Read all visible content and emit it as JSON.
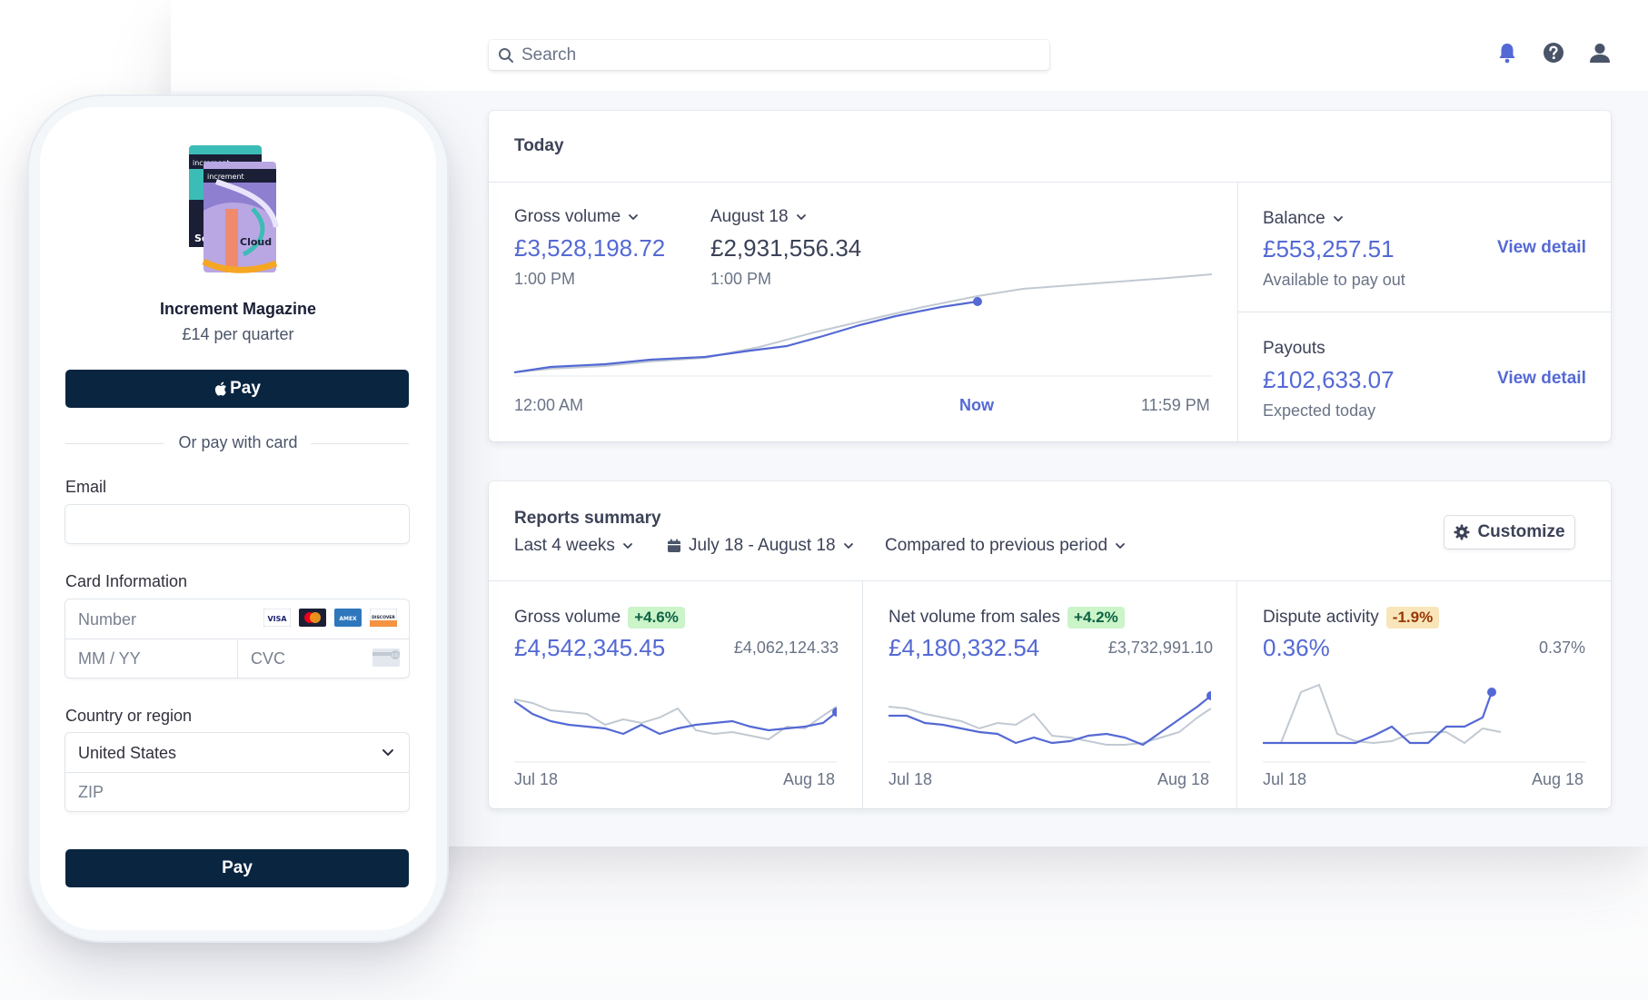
{
  "search": {
    "placeholder": "Search"
  },
  "today": {
    "title": "Today",
    "gross_volume": {
      "label": "Gross volume",
      "value": "£3,528,198.72",
      "time": "1:00 PM"
    },
    "compare_day": {
      "label": "August 18",
      "value": "£2,931,556.34",
      "time": "1:00 PM"
    },
    "axis": {
      "start": "12:00 AM",
      "now": "Now",
      "end": "11:59 PM"
    },
    "balance": {
      "label": "Balance",
      "value": "£553,257.51",
      "sub": "Available to pay out",
      "link": "View detail"
    },
    "payouts": {
      "label": "Payouts",
      "value": "£102,633.07",
      "sub": "Expected today",
      "link": "View detail"
    }
  },
  "reports": {
    "title": "Reports summary",
    "filter_period": "Last 4 weeks",
    "filter_dates": "July 18 - August 18",
    "filter_compare": "Compared to previous period",
    "customize_label": "Customize",
    "panels": [
      {
        "label": "Gross volume",
        "badge": "+4.6%",
        "value": "£4,542,345.45",
        "previous": "£4,062,124.33",
        "axis_start": "Jul 18",
        "axis_end": "Aug 18"
      },
      {
        "label": "Net volume from sales",
        "badge": "+4.2%",
        "value": "£4,180,332.54",
        "previous": "£3,732,991.10",
        "axis_start": "Jul 18",
        "axis_end": "Aug 18"
      },
      {
        "label": "Dispute activity",
        "badge": "-1.9%",
        "value": "0.36%",
        "previous": "0.37%",
        "axis_start": "Jul 18",
        "axis_end": "Aug 18"
      }
    ]
  },
  "checkout": {
    "product_name": "Increment Magazine",
    "product_price": "£14 per quarter",
    "product_art_text": [
      "increment",
      "increment",
      "Cloud",
      "So"
    ],
    "apple_pay_label": "Pay",
    "divider_text": "Or pay with card",
    "email_label": "Email",
    "email_value": "",
    "card_label": "Card Information",
    "number_placeholder": "Number",
    "expiry_placeholder": "MM / YY",
    "cvc_placeholder": "CVC",
    "card_brands": [
      "VISA",
      "MC",
      "AMEX",
      "DISCOVER"
    ],
    "cvc_badge": "135",
    "country_label": "Country or region",
    "country_value": "United States",
    "zip_placeholder": "ZIP",
    "pay_label": "Pay"
  },
  "colors": {
    "accent": "#5469d4",
    "comparison_line": "#c1c9d2",
    "button_dark": "#0a2540",
    "badge_green_bg": "#cbf4c9",
    "badge_orange_bg": "#f8e5b9"
  },
  "icons": [
    "search-icon",
    "bell-icon",
    "help-icon",
    "user-icon",
    "chevron-down-icon",
    "calendar-icon",
    "gear-icon",
    "apple-icon"
  ]
}
